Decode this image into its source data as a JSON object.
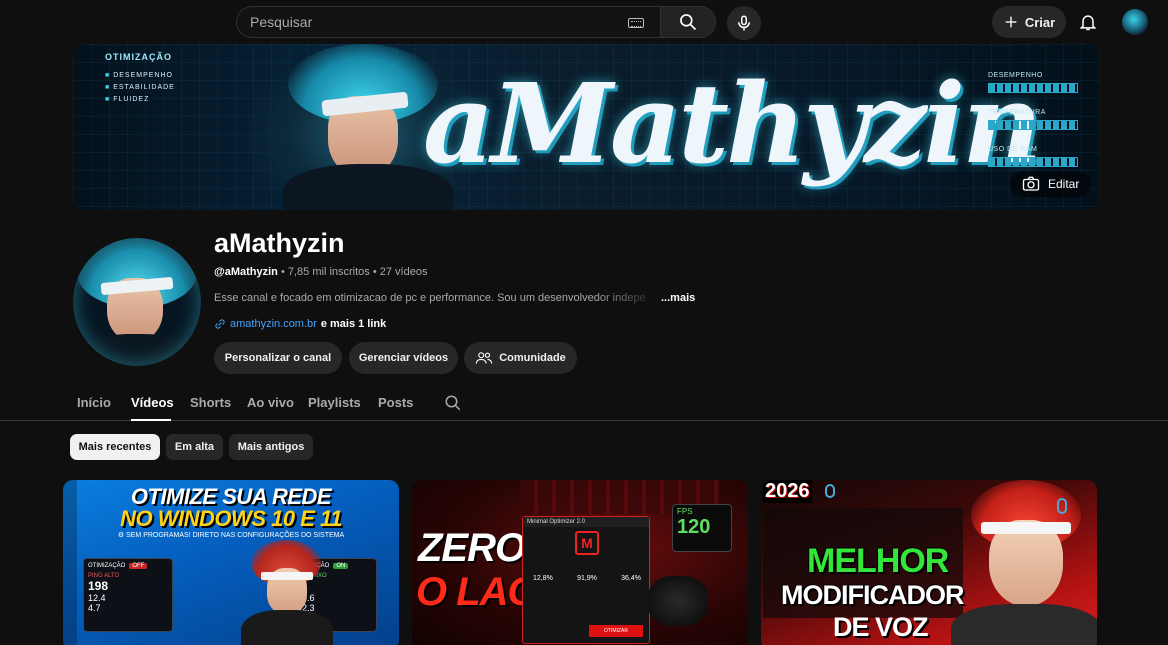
{
  "topbar": {
    "search_placeholder": "Pesquisar",
    "create_label": "Criar"
  },
  "banner": {
    "title": "aMathyzin",
    "left_heading": "OTIMIZAÇÃO",
    "left_items": [
      "DESEMPENHO",
      "ESTABILIDADE",
      "FLUIDEZ"
    ],
    "right_labels": [
      "DESEMPENHO",
      "TEMPERATURA",
      "USO DE RAM"
    ],
    "edit_label": "Editar"
  },
  "channel": {
    "name": "aMathyzin",
    "handle": "@aMathyzin",
    "meta": " • 7,85 mil inscritos • 27 vídeos",
    "description": "Esse canal e focado em otimizacao de pc e performance. Sou um desenvolvedor indepe",
    "more_label": "...mais",
    "link_url": "amathyzin.com.br",
    "link_extra": " e mais 1 link",
    "buttons": {
      "customize": "Personalizar o canal",
      "manage": "Gerenciar vídeos",
      "community": "Comunidade"
    }
  },
  "tabs": [
    {
      "label": "Início"
    },
    {
      "label": "Vídeos"
    },
    {
      "label": "Shorts"
    },
    {
      "label": "Ao vivo"
    },
    {
      "label": "Playlists"
    },
    {
      "label": "Posts"
    }
  ],
  "chips": [
    {
      "label": "Mais recentes"
    },
    {
      "label": "Em alta"
    },
    {
      "label": "Mais antigos"
    }
  ],
  "videos": [
    {
      "line1": "OTIMIZE SUA REDE",
      "line2": "NO WINDOWS 10 E 11",
      "line3": "SEM PROGRAMAS! DIRETO NAS CONFIGURAÇÕES DO SISTEMA",
      "panel_off": {
        "heading": "OTIMIZAÇÃO",
        "tag": "OFF",
        "ping_label": "PING ALTO",
        "ping": "198",
        "download": "12.4",
        "upload": "4.7"
      },
      "panel_on": {
        "heading": "OTIMIZAÇÃO",
        "tag": "ON",
        "ping_label": "PING BAIXO",
        "ping": "9",
        "download": "948.6",
        "upload": "892.3"
      }
    },
    {
      "line1": "ZEROU",
      "line2": "O LAG!",
      "app_title": "Minimal Optimizer 2.0",
      "stats": [
        "12,8%",
        "91,9%",
        "36,4%"
      ],
      "button": "OTIMIZAR",
      "fps_label": "FPS",
      "fps_value": "120"
    },
    {
      "year": "2026",
      "line1": "MELHOR",
      "line2": "MODIFICADOR",
      "line3": "DE VOZ"
    }
  ]
}
